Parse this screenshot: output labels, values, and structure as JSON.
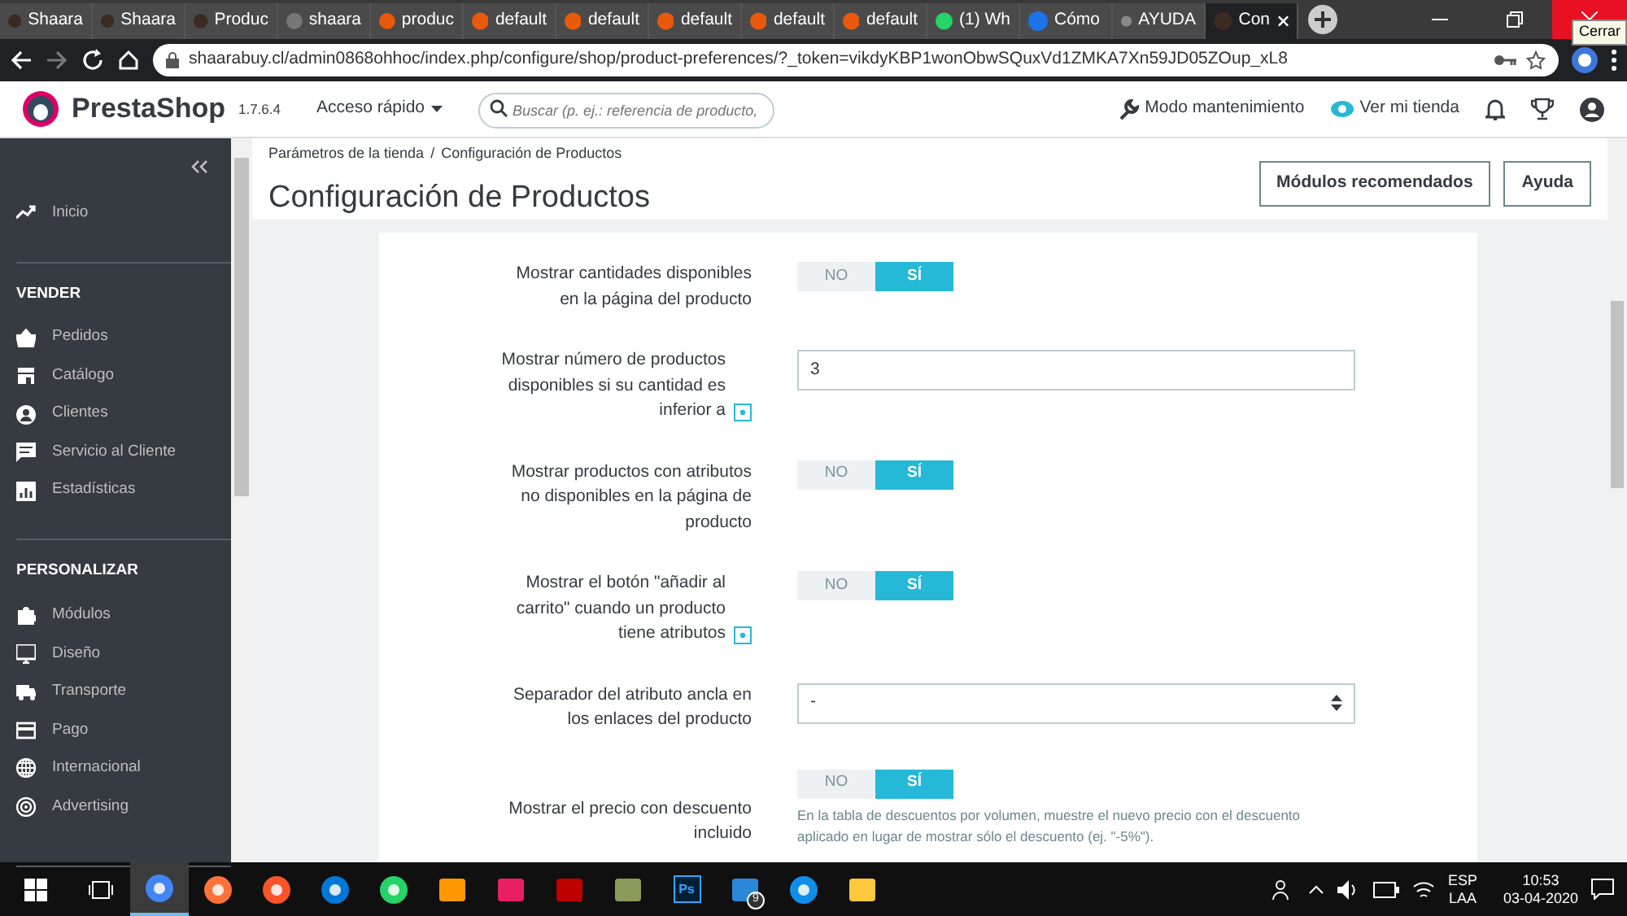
{
  "browser": {
    "tabs": [
      {
        "title": "Shaara",
        "selected": false
      },
      {
        "title": "Shaara",
        "selected": false
      },
      {
        "title": "Produc",
        "selected": false
      },
      {
        "title": "shaara",
        "selected": false
      },
      {
        "title": "produc",
        "selected": false
      },
      {
        "title": "default",
        "selected": false
      },
      {
        "title": "default",
        "selected": false
      },
      {
        "title": "default",
        "selected": false
      },
      {
        "title": "default",
        "selected": false
      },
      {
        "title": "default",
        "selected": false
      },
      {
        "title": "(1) Wh",
        "selected": false
      },
      {
        "title": "Cómo",
        "selected": false
      },
      {
        "title": "AYUDA",
        "selected": false
      },
      {
        "title": "Con",
        "selected": true
      }
    ],
    "tooltip": "Cerrar",
    "url": "shaarabuy.cl/admin0868ohhoc/index.php/configure/shop/product-preferences/?_token=vikdyKBP1wonObwSQuxVd1ZMKA7Xn59JD05ZOup_xL8"
  },
  "header": {
    "logo": "PrestaShop",
    "version": "1.7.6.4",
    "quick_access": "Acceso rápido",
    "search": {
      "placeholder": "Buscar (p. ej.: referencia de producto,"
    },
    "maintenance": "Modo mantenimiento",
    "view_shop": "Ver mi tienda"
  },
  "sidebar": {
    "sections": [
      {
        "items": [
          {
            "label": "Inicio"
          }
        ]
      },
      {
        "title": "VENDER",
        "items": [
          {
            "label": "Pedidos"
          },
          {
            "label": "Catálogo"
          },
          {
            "label": "Clientes"
          },
          {
            "label": "Servicio al Cliente"
          },
          {
            "label": "Estadísticas"
          }
        ]
      },
      {
        "title": "PERSONALIZAR",
        "items": [
          {
            "label": "Módulos"
          },
          {
            "label": "Diseño"
          },
          {
            "label": "Transporte"
          },
          {
            "label": "Pago"
          },
          {
            "label": "Internacional"
          },
          {
            "label": "Advertising"
          }
        ]
      }
    ]
  },
  "page": {
    "breadcrumb_separator": "/",
    "breadcrumb": [
      "Parámetros de la tienda",
      "Configuración de Productos"
    ],
    "title": "Configuración de Productos",
    "buttons": [
      "Módulos recomendados",
      "Ayuda"
    ]
  },
  "form": {
    "fields": [
      {
        "kind": "toggle",
        "label": "Mostrar cantidades disponibles en la página del producto",
        "options": [
          {
            "label": "NO",
            "selected": false
          },
          {
            "label": "SÍ",
            "selected": true
          }
        ]
      },
      {
        "kind": "text",
        "label": "Mostrar número de productos disponibles si su cantidad es inferior a",
        "help": true,
        "value": "3"
      },
      {
        "kind": "toggle",
        "label": "Mostrar productos con atributos no disponibles en la página de producto",
        "options": [
          {
            "label": "NO",
            "selected": false
          },
          {
            "label": "SÍ",
            "selected": true
          }
        ]
      },
      {
        "kind": "toggle",
        "label": "Mostrar el botón \"añadir al carrito\" cuando un producto tiene atributos",
        "help": true,
        "options": [
          {
            "label": "NO",
            "selected": false
          },
          {
            "label": "SÍ",
            "selected": true
          }
        ]
      },
      {
        "kind": "select",
        "label": "Separador del atributo ancla en los enlaces del producto",
        "value": "-"
      },
      {
        "kind": "toggle",
        "label": "Mostrar el precio con descuento incluido",
        "options": [
          {
            "label": "NO",
            "selected": false
          },
          {
            "label": "SÍ",
            "selected": true
          }
        ],
        "hint": "En la tabla de descuentos por volumen, muestre el nuevo precio con el descuento aplicado en lugar de mostrar sólo el descuento (ej. \"-5%\")."
      }
    ]
  },
  "taskbar": {
    "apps": [
      {
        "kind": "chrome",
        "selected": true
      },
      {
        "kind": "firefox",
        "selected": false
      },
      {
        "kind": "brave",
        "selected": false
      },
      {
        "kind": "edge",
        "selected": false
      },
      {
        "kind": "whatsapp",
        "selected": false
      },
      {
        "kind": "sublime",
        "selected": false
      },
      {
        "kind": "winamp",
        "selected": false
      },
      {
        "kind": "filezilla",
        "selected": false
      },
      {
        "kind": "tool",
        "selected": false
      },
      {
        "kind": "photoshop",
        "label": "Ps",
        "selected": false
      },
      {
        "kind": "mail",
        "badge": "9",
        "selected": false
      },
      {
        "kind": "teamviewer",
        "selected": false
      },
      {
        "kind": "folder",
        "selected": false
      }
    ],
    "language": [
      "ESP",
      "LAA"
    ],
    "time": "10:53",
    "date": "03-04-2020"
  }
}
